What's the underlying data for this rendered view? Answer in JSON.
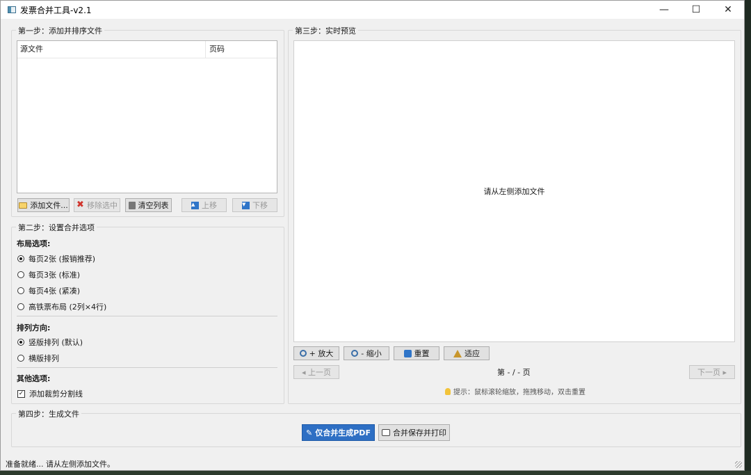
{
  "window": {
    "title": "发票合并工具-v2.1",
    "minimize": "—",
    "maximize": "☐",
    "close": "✕"
  },
  "step1": {
    "title": "第一步：添加并排序文件",
    "columns": {
      "source": "源文件",
      "page": "页码"
    },
    "buttons": {
      "add": "添加文件...",
      "remove": "移除选中",
      "clear": "清空列表",
      "up": "上移",
      "down": "下移"
    }
  },
  "step2": {
    "title": "第二步：设置合并选项",
    "layout_label": "布局选项:",
    "layout_options": [
      "每页2张 (报销推荐)",
      "每页3张 (标准)",
      "每页4张 (紧凑)",
      "高铁票布局 (2列×4行)"
    ],
    "layout_selected": 0,
    "orientation_label": "排列方向:",
    "orientation_options": [
      "竖版排列 (默认)",
      "横版排列"
    ],
    "orientation_selected": 0,
    "other_label": "其他选项:",
    "cut_line": "添加裁剪分割线",
    "cut_line_checked": true
  },
  "step3": {
    "title": "第三步：实时预览",
    "placeholder": "请从左侧添加文件",
    "buttons": {
      "zoom_in": "+ 放大",
      "zoom_out": "- 缩小",
      "reset": "重置",
      "fit": "适应"
    },
    "prev": "◂ 上一页",
    "next": "下一页 ▸",
    "page_indicator": "第 - / - 页",
    "tip": "提示：鼠标滚轮缩放，拖拽移动，双击重置"
  },
  "step4": {
    "title": "第四步：生成文件",
    "merge_pdf": "仅合并生成PDF",
    "save_print": "合并保存并打印"
  },
  "status": {
    "text": "准备就绪... 请从左侧添加文件。"
  }
}
